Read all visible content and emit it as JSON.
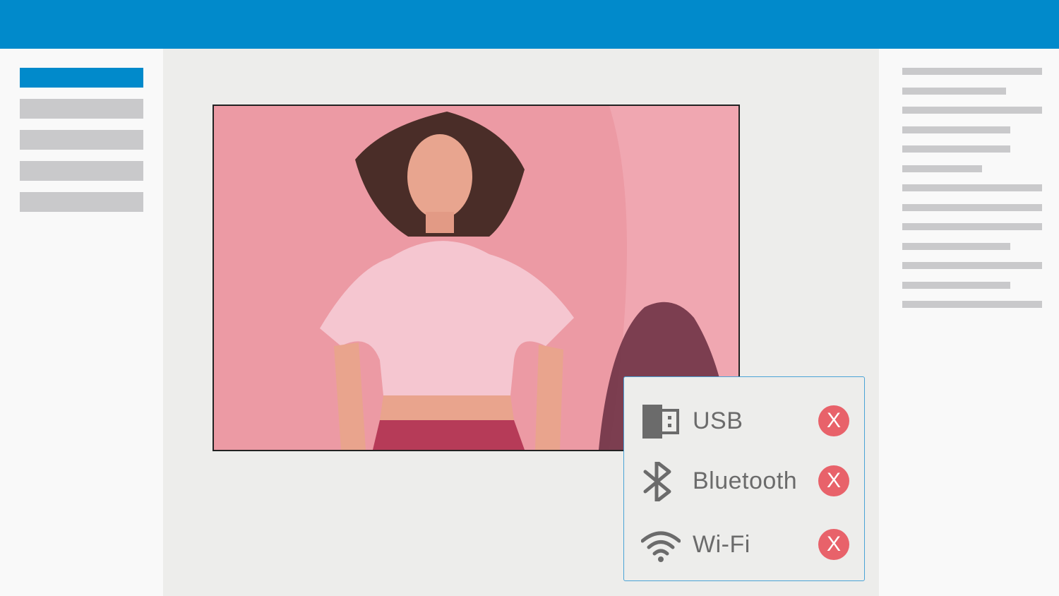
{
  "colors": {
    "accent": "#018acb",
    "skeleton": "#c9c9cb",
    "remove": "#e8626a"
  },
  "devices": [
    {
      "label": "USB",
      "icon": "usb-icon",
      "action": "X"
    },
    {
      "label": "Bluetooth",
      "icon": "bluetooth-icon",
      "action": "X"
    },
    {
      "label": "Wi-Fi",
      "icon": "wifi-icon",
      "action": "X"
    }
  ]
}
